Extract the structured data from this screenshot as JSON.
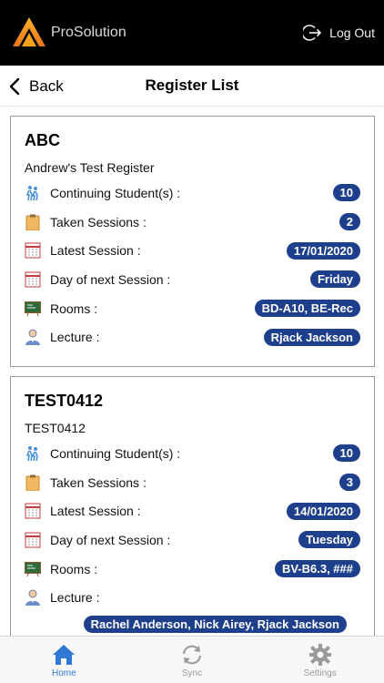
{
  "header": {
    "brand": "ProSolution",
    "logout_label": "Log Out"
  },
  "nav": {
    "back_label": "Back",
    "title": "Register List"
  },
  "registers": [
    {
      "code": "ABC",
      "name": "Andrew's Test Register",
      "rows": [
        {
          "label": "Continuing Student(s) :",
          "value": "10",
          "icon": "students-icon"
        },
        {
          "label": "Taken Sessions :",
          "value": "2",
          "icon": "clipboard-icon"
        },
        {
          "label": "Latest Session :",
          "value": "17/01/2020",
          "icon": "calendar-icon"
        },
        {
          "label": "Day of next Session :",
          "value": "Friday",
          "icon": "calendar-icon"
        },
        {
          "label": "Rooms :",
          "value": "BD-A10, BE-Rec",
          "icon": "chalkboard-icon"
        },
        {
          "label": "Lecture :",
          "value": "Rjack Jackson",
          "icon": "lecturer-icon"
        }
      ]
    },
    {
      "code": "TEST0412",
      "name": "TEST0412",
      "rows": [
        {
          "label": "Continuing Student(s) :",
          "value": "10",
          "icon": "students-icon"
        },
        {
          "label": "Taken Sessions :",
          "value": "3",
          "icon": "clipboard-icon"
        },
        {
          "label": "Latest Session :",
          "value": "14/01/2020",
          "icon": "calendar-icon"
        },
        {
          "label": "Day of next Session :",
          "value": "Tuesday",
          "icon": "calendar-icon"
        },
        {
          "label": "Rooms :",
          "value": "BV-B6.3, ###",
          "icon": "chalkboard-icon"
        },
        {
          "label": "Lecture :",
          "value": "Rachel Anderson, Nick Airey, Rjack Jackson",
          "icon": "lecturer-icon"
        }
      ]
    }
  ],
  "tabbar": {
    "items": [
      {
        "label": "Home",
        "icon": "home-icon",
        "active": true
      },
      {
        "label": "Sync",
        "icon": "sync-icon",
        "active": false
      },
      {
        "label": "Settings",
        "icon": "gear-icon",
        "active": false
      }
    ]
  },
  "colors": {
    "badge": "#1e3f8c",
    "accent": "#2f78d6",
    "logo": "#f5a21b"
  }
}
